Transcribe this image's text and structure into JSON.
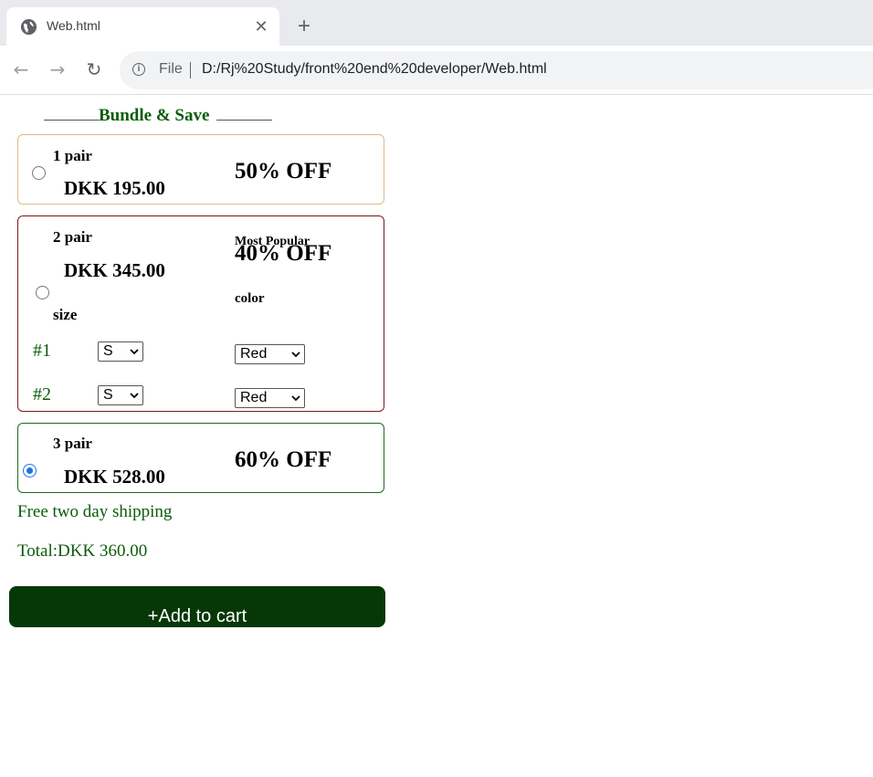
{
  "browser": {
    "tab_title": "Web.html",
    "tab_close": "✕",
    "new_tab": "+",
    "nav": {
      "back": "←",
      "forward": "→",
      "reload": "↻"
    },
    "scheme_label": "File",
    "url": "D:/Rj%20Study/front%20end%20developer/Web.html"
  },
  "page": {
    "heading": "Bundle & Save",
    "offers": [
      {
        "pairs": "1 pair",
        "price": "DKK 195.00",
        "discount": "50% OFF",
        "selected": false
      },
      {
        "pairs": "2 pair",
        "price": "DKK 345.00",
        "discount": "40% OFF",
        "badge": "Most Popular",
        "selected": false,
        "size_label": "size",
        "color_label": "color",
        "rows": [
          {
            "label": "#1",
            "size": "S",
            "color": "Red"
          },
          {
            "label": "#2",
            "size": "S",
            "color": "Red"
          }
        ]
      },
      {
        "pairs": "3 pair",
        "price": "DKK 528.00",
        "discount": "60% OFF",
        "selected": true
      }
    ],
    "shipping": "Free two day shipping",
    "total": "Total:DKK 360.00",
    "add_to_cart": "+Add to cart"
  },
  "colors": {
    "heading_green": "#0a5c0a",
    "button_bg": "#063806",
    "card1_border": "#e0b98a",
    "card2_border": "#7a1a22",
    "card3_border": "#1e6b1e",
    "radio_checked": "#1a73e8"
  }
}
